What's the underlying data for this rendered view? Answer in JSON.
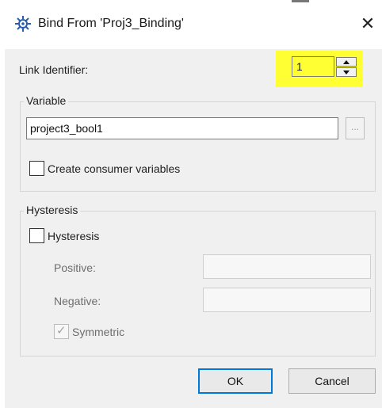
{
  "window": {
    "title": "Bind From 'Proj3_Binding'",
    "close_glyph": "✕",
    "title_icon": "gear-network-icon"
  },
  "link_identifier": {
    "label": "Link Identifier:",
    "value": "1",
    "highlight_color": "#ffff33"
  },
  "variable_group": {
    "title": "Variable",
    "value": "project3_bool1",
    "browse_label": "...",
    "create_consumer_label": "Create consumer variables",
    "create_consumer_checked": false
  },
  "hysteresis_group": {
    "title": "Hysteresis",
    "checkbox_label": "Hysteresis",
    "checkbox_checked": false,
    "positive_label": "Positive:",
    "positive_value": "",
    "negative_label": "Negative:",
    "negative_value": "",
    "symmetric_label": "Symmetric",
    "symmetric_checked": true
  },
  "buttons": {
    "ok": "OK",
    "cancel": "Cancel"
  }
}
